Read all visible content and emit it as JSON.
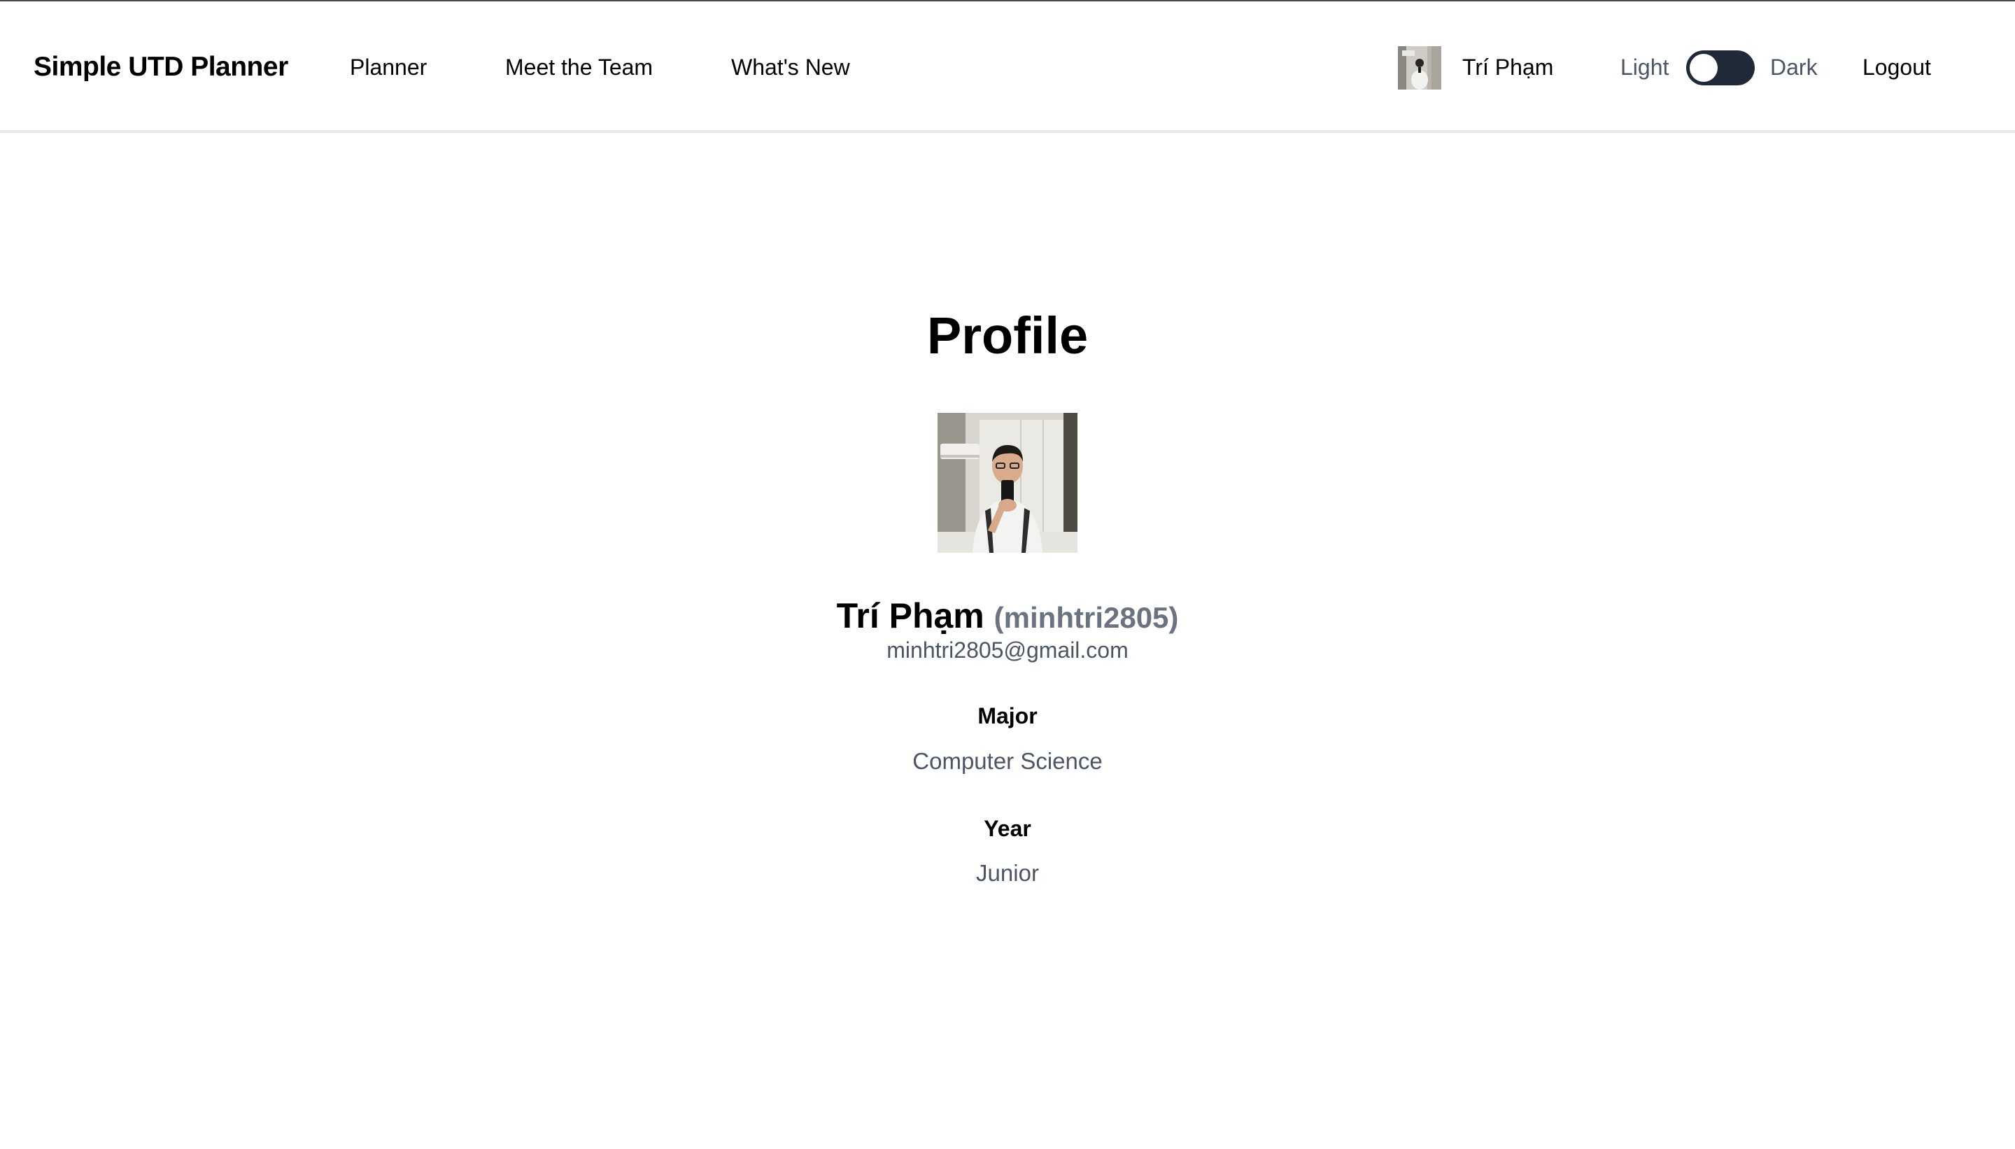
{
  "navbar": {
    "brand": "Simple UTD Planner",
    "links": [
      "Planner",
      "Meet the Team",
      "What's New"
    ],
    "user_name": "Trí Phạm",
    "theme_light_label": "Light",
    "theme_dark_label": "Dark",
    "theme_mode": "light",
    "logout_label": "Logout"
  },
  "profile": {
    "title": "Profile",
    "display_name": "Trí Phạm",
    "username": "(minhtri2805)",
    "email": "minhtri2805@gmail.com",
    "fields": [
      {
        "label": "Major",
        "value": "Computer Science"
      },
      {
        "label": "Year",
        "value": "Junior"
      }
    ]
  },
  "colors": {
    "toggle_track": "#1f2937",
    "muted_text": "#4b5563",
    "username_text": "#6b7280"
  }
}
